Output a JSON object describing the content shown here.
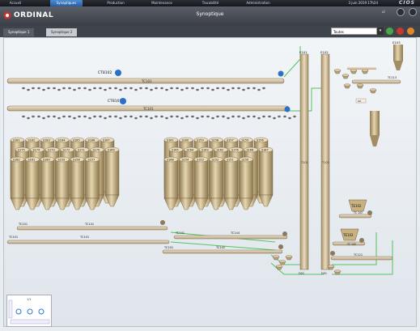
{
  "nav": {
    "items": [
      "Accueil",
      "Synoptiques",
      "Production",
      "Maintenance",
      "Tracabilité",
      "Administration"
    ],
    "active_index": 1,
    "date": "3 juin 2019 17h24",
    "brand_right": "CIOS"
  },
  "header": {
    "logo_text": "ORDINAL",
    "title": "Synoptique",
    "user_badge": "ul"
  },
  "tabs": [
    {
      "label": "Synoptique 1"
    },
    {
      "label": "Synoptique 2"
    }
  ],
  "filter": {
    "selected": "Toutes"
  },
  "colors": {
    "accent": "#2b7bd1",
    "tube": "#d4c2a6",
    "conveyor": "#dcc9aa",
    "green_line": "#4cbf55",
    "silo": "#c8b48a"
  },
  "labels": {
    "ct_top": "CT8102",
    "ct_second": "CT8101",
    "belt_top": "TC101",
    "belt_second": "TC101",
    "e101": "E101",
    "e102": "E102",
    "t_left": "T101",
    "t_right": "T102",
    "tc_b1": "TC101",
    "tc_b2": "TC101",
    "tc_right1": "TC113",
    "e103": "E103",
    "tc_lower1": "TC101",
    "tc_lower2": "TC101",
    "tc_lower3": "TC101",
    "tc_lower4": "TC141",
    "tc_lower5": "TC142",
    "tc_lower6": "TC144",
    "te1": "TE102",
    "te2": "TE102",
    "te_tc1": "TC 102",
    "te_tc2": "TC 102",
    "tc_bottom_right": "TC121",
    "bottom_d1": "D01",
    "bottom_d2": "D01",
    "tag": "OK"
  },
  "silos_left": [
    "S181",
    "S182",
    "S183",
    "S184",
    "S185",
    "S186",
    "S187",
    "S175",
    "S174",
    "S173",
    "S172",
    "S171",
    "S170",
    "S169",
    "S162",
    "S161",
    "S160",
    "S159",
    "S158",
    "S157"
  ],
  "silos_right": [
    "S161",
    "S160",
    "S159",
    "S158",
    "S157",
    "S155",
    "S156",
    "S165",
    "S164",
    "S163",
    "S162",
    "S176",
    "S166",
    "S167",
    "S168",
    "S154",
    "S153",
    "S152",
    "S151",
    "S150"
  ],
  "zoom": {
    "level": "1/1"
  }
}
